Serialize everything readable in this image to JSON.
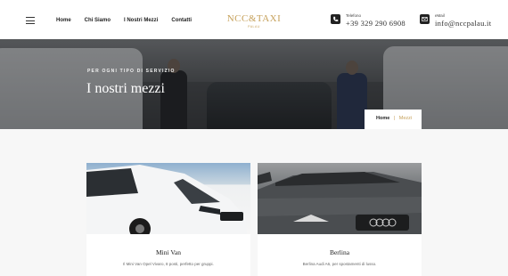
{
  "header": {
    "nav": [
      "Home",
      "Chi Siamo",
      "I Nostri Mezzi",
      "Contatti"
    ],
    "logo_title": "NCC&TAXI",
    "logo_subtitle": "PALAU",
    "phone_label": "Telefono",
    "phone_value": "+39 329 290 6908",
    "email_label": "eMail",
    "email_value": "info@nccpalau.it"
  },
  "hero": {
    "kicker": "PER OGNI TIPO DI SERVIZIO",
    "title": "I nostri mezzi",
    "breadcrumb_home": "Home",
    "breadcrumb_sep": "|",
    "breadcrumb_current": "Mezzi"
  },
  "cards": [
    {
      "title": "Mini Van",
      "description": "Il Mini Van Opel Vivaro, 8 posti, perfetto per gruppi."
    },
    {
      "title": "Berlina",
      "description": "Berlina Audi A6, per spostamenti di lusso."
    }
  ],
  "colors": {
    "accent": "#c6a15b"
  },
  "icons": {
    "menu": "hamburger-icon",
    "phone": "phone-icon",
    "email": "mail-icon"
  }
}
